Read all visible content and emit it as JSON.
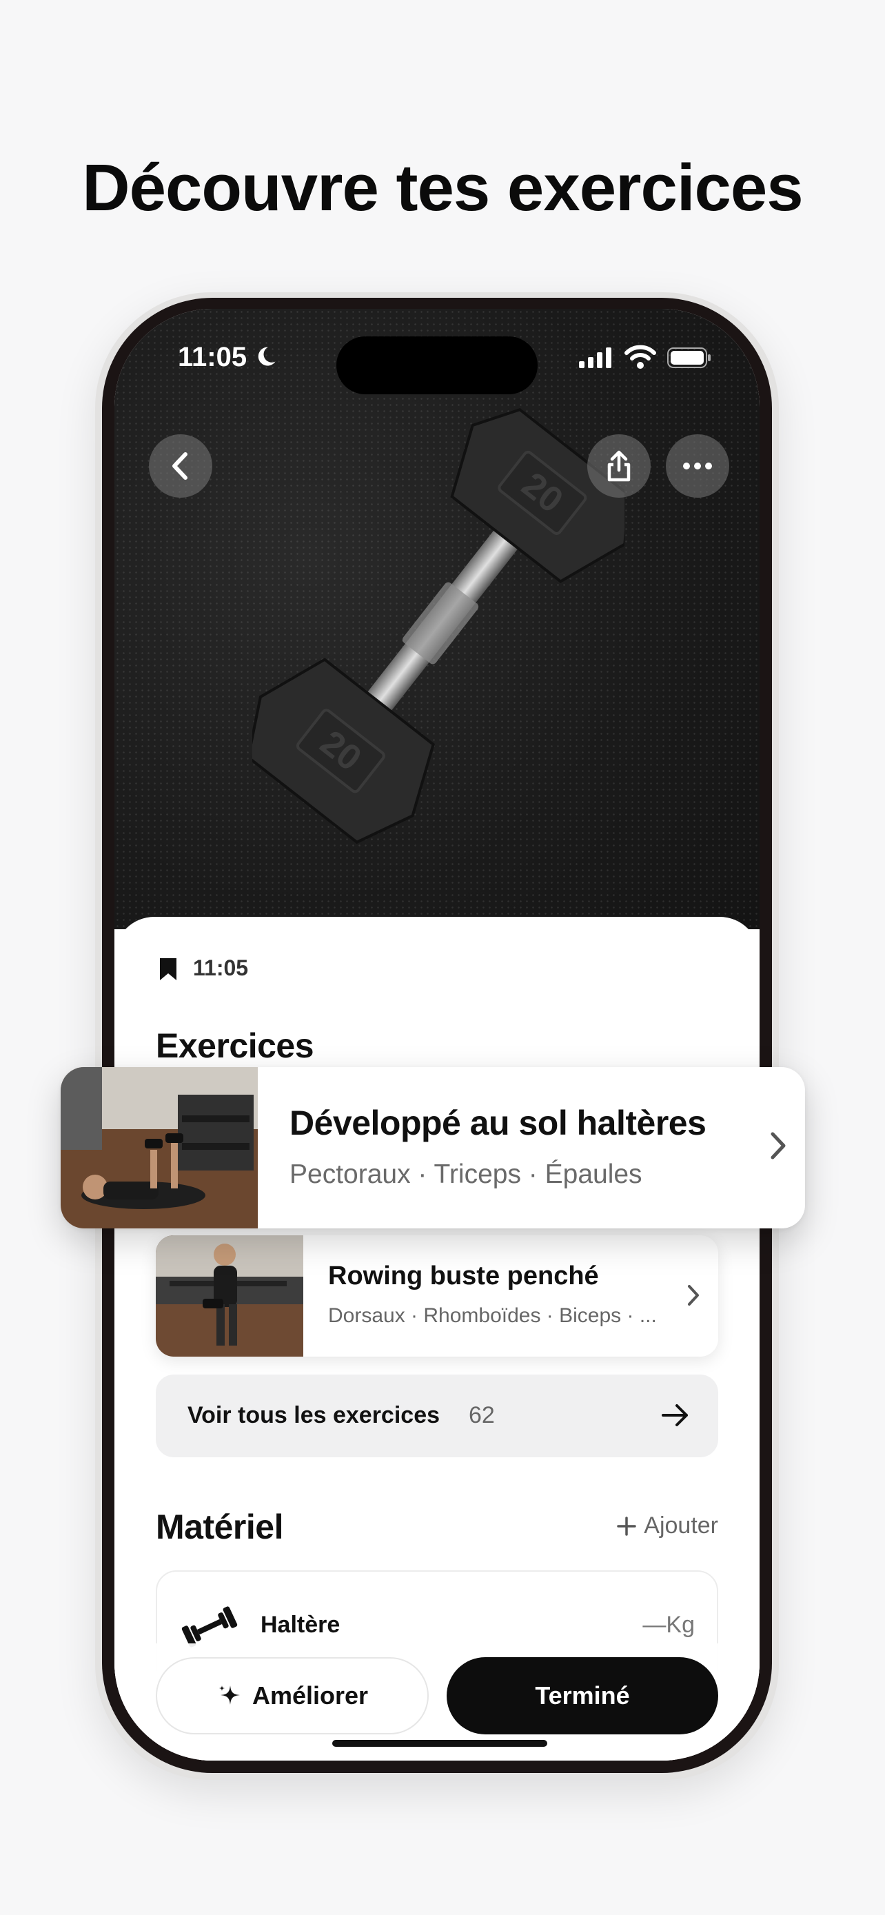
{
  "headline": "Découvre tes exercices",
  "status_bar": {
    "time": "11:05",
    "icons": [
      "moon-icon",
      "signal-icon",
      "wifi-icon",
      "battery-icon"
    ]
  },
  "hero": {
    "image": "dumbbell-photo",
    "weight_label": "20",
    "buttons": [
      "back-icon",
      "share-icon",
      "more-icon"
    ]
  },
  "sheet": {
    "time": "11:05",
    "exercises_title": "Exercices",
    "exercises": [
      {
        "name": "Développé au sol haltères",
        "muscles": "Pectoraux · Triceps · Épaules"
      },
      {
        "name": "Rowing buste penché",
        "muscles": "Dorsaux · Rhomboïdes · Biceps · ..."
      }
    ],
    "see_all": {
      "label": "Voir tous les exercices",
      "count": "62"
    },
    "equipment_title": "Matériel",
    "add_label": "Ajouter",
    "equipment": [
      {
        "name": "Haltère",
        "value": "—Kg"
      }
    ]
  },
  "actions": {
    "improve_label": "Améliorer",
    "done_label": "Terminé"
  },
  "colors": {
    "background": "#f7f7f8",
    "primary_button": "#0d0d0d",
    "secondary_text": "#6a6a6a"
  }
}
